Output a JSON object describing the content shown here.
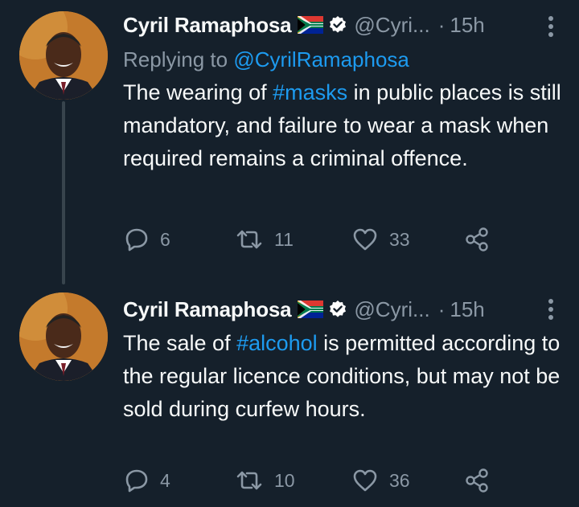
{
  "tweets": [
    {
      "author": "Cyril Ramaphosa",
      "handle": "@Cyri...",
      "dot": "·",
      "time": "15h",
      "reply_prefix": "Replying to ",
      "reply_to": "@CyrilRamaphosa",
      "text": {
        "p1": "The wearing of ",
        "hashtag": "#masks",
        "p2": " in public places is still mandatory, and failure to wear a mask when required remains a criminal offence."
      },
      "replies": "6",
      "retweets": "11",
      "likes": "33"
    },
    {
      "author": "Cyril Ramaphosa",
      "handle": "@Cyri...",
      "dot": "·",
      "time": "15h",
      "text": {
        "p1": "The sale of ",
        "hashtag": "#alcohol",
        "p2": " is permitted according to the regular licence conditions, but may not be sold during curfew hours."
      },
      "replies": "4",
      "retweets": "10",
      "likes": "36"
    }
  ],
  "colors": {
    "background": "#15202b",
    "text": "#f7f9f9",
    "muted": "#8b98a5",
    "accent": "#1d9bf0",
    "thread_line": "#38444d"
  },
  "icons": [
    "south-africa-flag-icon",
    "verified-badge-icon",
    "more-icon",
    "reply-icon",
    "retweet-icon",
    "like-icon",
    "share-icon"
  ]
}
